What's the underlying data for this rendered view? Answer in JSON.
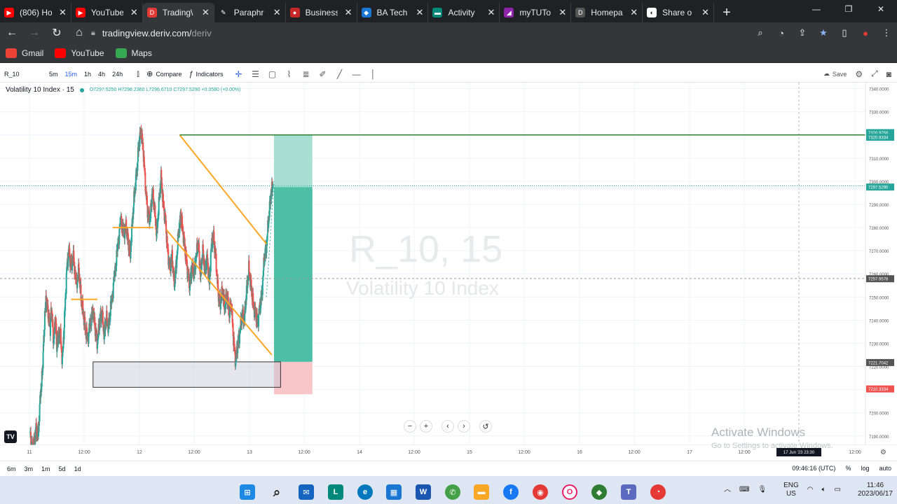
{
  "browser": {
    "tabs": [
      {
        "label": "(806) Ho",
        "color": "#ff0000",
        "glyph": "▶"
      },
      {
        "label": "YouTube",
        "color": "#ff0000",
        "glyph": "▶"
      },
      {
        "label": "Trading\\",
        "color": "#e53935",
        "glyph": "D",
        "active": true
      },
      {
        "label": "Paraphr",
        "color": "#202124",
        "glyph": "✎"
      },
      {
        "label": "Business",
        "color": "#c62828",
        "glyph": "●"
      },
      {
        "label": "BA Tech",
        "color": "#1976d2",
        "glyph": "◆"
      },
      {
        "label": "Activity",
        "color": "#00897b",
        "glyph": "▬"
      },
      {
        "label": "myTUTo",
        "color": "#8e24aa",
        "glyph": "◢"
      },
      {
        "label": "Homepa",
        "color": "#555555",
        "glyph": "D"
      },
      {
        "label": "Share o",
        "color": "#ffffff",
        "glyph": "◐"
      }
    ],
    "new_tab": "+",
    "url_host": "tradingview.deriv.com/",
    "url_path": "deriv",
    "bookmarks": [
      {
        "label": "Gmail",
        "color": "#ea4335"
      },
      {
        "label": "YouTube",
        "color": "#ff0000"
      },
      {
        "label": "Maps",
        "color": "#34a853"
      }
    ]
  },
  "toolbar": {
    "symbol": "R_10",
    "intervals": [
      "5m",
      "15m",
      "1h",
      "4h",
      "24h"
    ],
    "selected_interval": "15m",
    "compare": "Compare",
    "indicators": "Indicators",
    "save": "Save"
  },
  "legend": {
    "title": "Volatility 10 Index · 15",
    "ohlc": "O7297.5250 H7298.2360 L7296.6710 C7297.5290 +0.0580 (+0.00%)"
  },
  "watermark": {
    "symbol": "R_10, 15",
    "name": "Volatility 10 Index"
  },
  "activation": {
    "line1": "Activate Windows",
    "line2": "Go to Settings to activate Windows."
  },
  "bottom": {
    "ranges": [
      "6m",
      "3m",
      "1m",
      "5d",
      "1d"
    ],
    "time": "09:46:16 (UTC)",
    "percent": "%",
    "log": "log",
    "auto": "auto"
  },
  "taskbar": {
    "lang": "ENG",
    "region": "US",
    "clock_time": "11:46",
    "clock_date": "2023/06/17"
  },
  "chart_data": {
    "type": "candlestick",
    "ylim": [
      7186,
      7342
    ],
    "y_ticks": [
      "7340.0000",
      "7330.0000",
      "7320.0000",
      "7310.0000",
      "7300.0000",
      "7290.0000",
      "7280.0000",
      "7270.0000",
      "7260.0000",
      "7250.0000",
      "7240.0000",
      "7230.0000",
      "7220.0000",
      "7210.0000",
      "7200.0000",
      "7190.0000"
    ],
    "x_ticks": [
      "11",
      "12:00",
      "12",
      "12:00",
      "13",
      "12:00",
      "14",
      "12:00",
      "15",
      "12:00",
      "16",
      "12:00",
      "17",
      "12:00",
      "12:00"
    ],
    "price_labels": [
      {
        "text": "7320.9758",
        "value": 7321.0,
        "color": "#26a69a"
      },
      {
        "text": "7320.9334",
        "value": 7319.0,
        "color": "#26a69a"
      },
      {
        "text": "7297.5290",
        "value": 7297.5,
        "color": "#26a69a"
      },
      {
        "text": "7257.9578",
        "value": 7257.9,
        "color": "#555555"
      },
      {
        "text": "7221.7042",
        "value": 7221.7,
        "color": "#555555"
      },
      {
        "text": "7210.3334",
        "value": 7210.3,
        "color": "#ef5350"
      }
    ],
    "crosshair_date": "17 Jun '23  23:30",
    "price_path": [
      [
        0.0,
        7190
      ],
      [
        0.04,
        7186
      ],
      [
        0.06,
        7193
      ],
      [
        0.08,
        7190
      ],
      [
        0.1,
        7208
      ],
      [
        0.12,
        7218
      ],
      [
        0.13,
        7232
      ],
      [
        0.15,
        7250
      ],
      [
        0.17,
        7243
      ],
      [
        0.19,
        7237
      ],
      [
        0.2,
        7245
      ],
      [
        0.22,
        7231
      ],
      [
        0.24,
        7240
      ],
      [
        0.25,
        7228
      ],
      [
        0.26,
        7232
      ],
      [
        0.28,
        7235
      ],
      [
        0.3,
        7222
      ],
      [
        0.32,
        7241
      ],
      [
        0.34,
        7262
      ],
      [
        0.36,
        7270
      ],
      [
        0.38,
        7263
      ],
      [
        0.4,
        7267
      ],
      [
        0.43,
        7255
      ],
      [
        0.45,
        7262
      ],
      [
        0.47,
        7250
      ],
      [
        0.49,
        7243
      ],
      [
        0.51,
        7236
      ],
      [
        0.53,
        7232
      ],
      [
        0.56,
        7240
      ],
      [
        0.58,
        7244
      ],
      [
        0.6,
        7236
      ],
      [
        0.62,
        7230
      ],
      [
        0.64,
        7240
      ],
      [
        0.66,
        7243
      ],
      [
        0.68,
        7234
      ],
      [
        0.7,
        7241
      ],
      [
        0.72,
        7237
      ],
      [
        0.74,
        7245
      ],
      [
        0.77,
        7257
      ],
      [
        0.8,
        7270
      ],
      [
        0.83,
        7283
      ],
      [
        0.86,
        7278
      ],
      [
        0.88,
        7280
      ],
      [
        0.9,
        7274
      ],
      [
        0.92,
        7268
      ],
      [
        0.94,
        7284
      ],
      [
        0.96,
        7296
      ],
      [
        0.98,
        7305
      ],
      [
        1.0,
        7318
      ],
      [
        1.02,
        7321
      ],
      [
        1.04,
        7312
      ],
      [
        1.06,
        7296
      ],
      [
        1.08,
        7286
      ],
      [
        1.1,
        7283
      ],
      [
        1.12,
        7296
      ],
      [
        1.14,
        7288
      ],
      [
        1.16,
        7277
      ],
      [
        1.18,
        7290
      ],
      [
        1.2,
        7302
      ],
      [
        1.22,
        7290
      ],
      [
        1.24,
        7283
      ],
      [
        1.26,
        7270
      ],
      [
        1.28,
        7262
      ],
      [
        1.3,
        7268
      ],
      [
        1.32,
        7255
      ],
      [
        1.34,
        7265
      ],
      [
        1.36,
        7278
      ],
      [
        1.38,
        7285
      ],
      [
        1.4,
        7278
      ],
      [
        1.42,
        7270
      ],
      [
        1.44,
        7262
      ],
      [
        1.46,
        7255
      ],
      [
        1.48,
        7263
      ],
      [
        1.5,
        7260
      ],
      [
        1.52,
        7268
      ],
      [
        1.54,
        7273
      ],
      [
        1.56,
        7259
      ],
      [
        1.58,
        7270
      ],
      [
        1.6,
        7261
      ],
      [
        1.62,
        7267
      ],
      [
        1.64,
        7256
      ],
      [
        1.66,
        7273
      ],
      [
        1.68,
        7276
      ],
      [
        1.7,
        7266
      ],
      [
        1.72,
        7252
      ],
      [
        1.74,
        7247
      ],
      [
        1.76,
        7253
      ],
      [
        1.78,
        7245
      ],
      [
        1.8,
        7251
      ],
      [
        1.82,
        7243
      ],
      [
        1.84,
        7247
      ],
      [
        1.86,
        7232
      ],
      [
        1.88,
        7222
      ],
      [
        1.9,
        7230
      ],
      [
        1.92,
        7235
      ],
      [
        1.94,
        7243
      ],
      [
        1.96,
        7240
      ],
      [
        1.98,
        7253
      ],
      [
        2.0,
        7262
      ],
      [
        2.02,
        7255
      ],
      [
        2.04,
        7247
      ],
      [
        2.06,
        7243
      ],
      [
        2.08,
        7239
      ],
      [
        2.1,
        7245
      ],
      [
        2.12,
        7252
      ],
      [
        2.14,
        7266
      ],
      [
        2.16,
        7272
      ],
      [
        2.18,
        7283
      ],
      [
        2.2,
        7294
      ],
      [
        2.22,
        7298
      ]
    ],
    "shapes": {
      "supports": [
        {
          "from": [
            0.38,
            7249
          ],
          "to": [
            0.62,
            7249
          ],
          "color": "#ffa726"
        },
        {
          "from": [
            0.76,
            7280
          ],
          "to": [
            1.13,
            7280
          ],
          "color": "#ffa726"
        }
      ],
      "channel_upper": {
        "from": [
          1.37,
          7320
        ],
        "to": [
          2.16,
          7273
        ],
        "color": "#ffa726"
      },
      "channel_lower": {
        "from": [
          1.25,
          7279
        ],
        "to": [
          2.21,
          7225
        ],
        "color": "#ffa726"
      },
      "resistance": {
        "from": [
          1.37,
          7320
        ],
        "to": [
          3.0,
          7320
        ],
        "color": "#2e7d32"
      },
      "demand_zone": {
        "x0": 0.58,
        "x1": 2.29,
        "y0": 7222,
        "y1": 7211
      },
      "long_position": {
        "x0": 2.23,
        "x1": 2.58,
        "entry": 7222,
        "target": 7320,
        "stop": 7210
      }
    }
  }
}
